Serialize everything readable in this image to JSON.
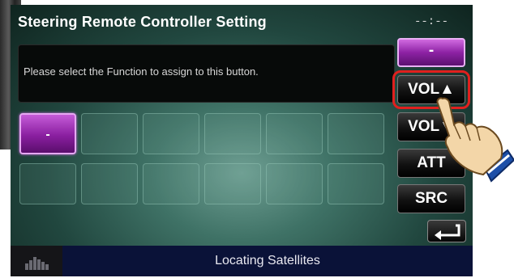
{
  "screen": {
    "title": "Steering Remote Controller Setting",
    "clock": "--:--",
    "message": "Please select the Function to assign to this button."
  },
  "grid": {
    "selected_label": "-"
  },
  "side_buttons": {
    "none": "-",
    "vol_up": "VOL▲",
    "vol_down": "VOL▼",
    "att": "ATT",
    "src": "SRC"
  },
  "status_bar": {
    "text": "Locating Satellites"
  },
  "colors": {
    "highlight": "#e0201e",
    "selected": "#8a1fa0",
    "status_bar": "#0a1238"
  }
}
